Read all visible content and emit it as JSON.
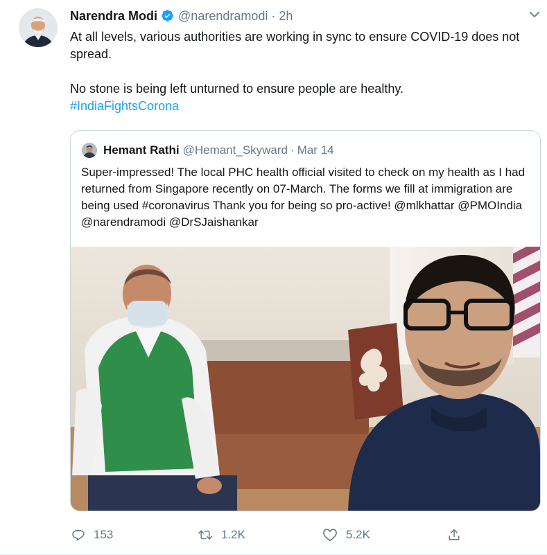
{
  "author": {
    "display_name": "Narendra Modi",
    "handle": "@narendramodi",
    "separator": "·",
    "time": "2h",
    "verified": true,
    "avatar_icon": "avatar-photo"
  },
  "tweet": {
    "line1": "At all levels, various authorities are working in sync to ensure COVID-19 does not spread.",
    "line2": "No stone is being left unturned to ensure people are healthy.",
    "hashtag": "#IndiaFightsCorona"
  },
  "quoted_tweet": {
    "display_name": "Hemant Rathi",
    "handle": "@Hemant_Skyward",
    "separator": "·",
    "date": "Mar 14",
    "text": "Super-impressed! The local PHC health official visited to check on my health as I had returned from Singapore recently on 07-March. The forms we fill at immigration are being used #coronavirus Thank you for being so pro-active! @mlkhattar @PMOIndia @narendramodi @DrSJaishankar"
  },
  "actions": {
    "replies": "153",
    "retweets": "1.2K",
    "likes": "5.2K"
  },
  "colors": {
    "link": "#1da1f2",
    "muted": "#657786",
    "border": "#ccd6dd"
  }
}
